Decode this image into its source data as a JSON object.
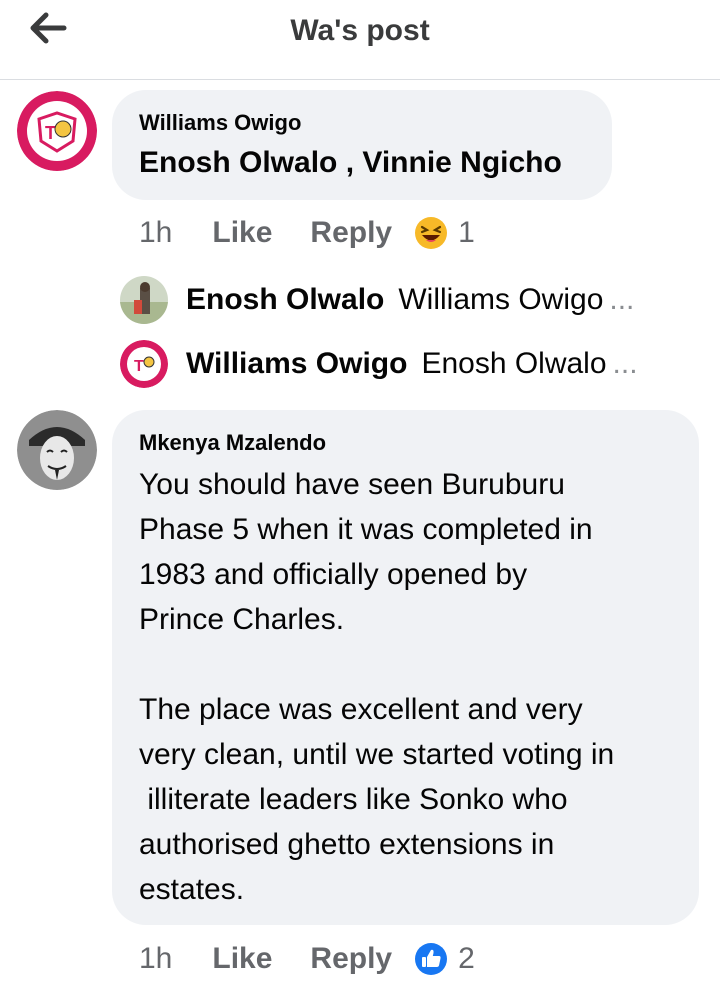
{
  "header": {
    "title": "Wa's post",
    "back_icon": "arrow-left-icon"
  },
  "comments": [
    {
      "author": "Williams Owigo",
      "text": "Enosh Olwalo , Vinnie Ngicho",
      "time": "1h",
      "like_label": "Like",
      "reply_label": "Reply",
      "reaction_icon": "laughing-emoji-icon",
      "reaction_count": "1",
      "avatar_colors": {
        "ring": "#d81b60",
        "inner": "#ffffff"
      }
    },
    {
      "author": "Mkenya Mzalendo",
      "text": "You should have seen Buruburu\nPhase 5 when it was completed in\n1983 and officially opened by\nPrince Charles.\n\nThe place was excellent and very\nvery clean, until we started voting in\n illiterate leaders like Sonko who\nauthorised ghetto extensions in\nestates.",
      "time": "1h",
      "like_label": "Like",
      "reply_label": "Reply",
      "reaction_icon": "thumbs-up-icon",
      "reaction_count": "2",
      "avatar_colors": {
        "bg": "#8f8f8f"
      }
    }
  ],
  "replies": [
    {
      "name": "Enosh Olwalo",
      "text": "Williams Owigo",
      "ellipsis": "..."
    },
    {
      "name": "Williams Owigo",
      "text": "Enosh Olwalo",
      "ellipsis": "..."
    }
  ],
  "colors": {
    "bubble": "#f0f2f5",
    "secondary_text": "#65676b",
    "like_blue": "#1877f2",
    "laugh_yellow": "#f7b928",
    "brand_pink": "#d81b60"
  }
}
